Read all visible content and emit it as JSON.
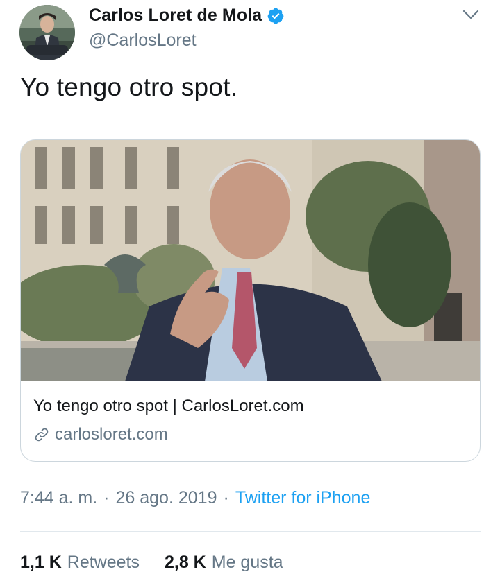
{
  "author": {
    "display_name": "Carlos Loret de Mola",
    "handle": "@CarlosLoret",
    "verified": true
  },
  "tweet": {
    "text": "Yo tengo otro spot."
  },
  "card": {
    "title": "Yo tengo otro spot | CarlosLoret.com",
    "domain": "carlosloret.com"
  },
  "meta": {
    "time": "7:44 a. m.",
    "separator": "·",
    "date": "26 ago. 2019",
    "source": "Twitter for iPhone"
  },
  "stats": {
    "retweets_count": "1,1 K",
    "retweets_label": "Retweets",
    "likes_count": "2,8 K",
    "likes_label": "Me gusta"
  },
  "colors": {
    "link": "#1da1f2",
    "secondary_text": "#657786",
    "verified_badge": "#1da1f2",
    "border": "#ccd6dd"
  },
  "icons": {
    "verified": "verified-badge-icon",
    "more": "chevron-down-icon",
    "link": "link-icon"
  }
}
